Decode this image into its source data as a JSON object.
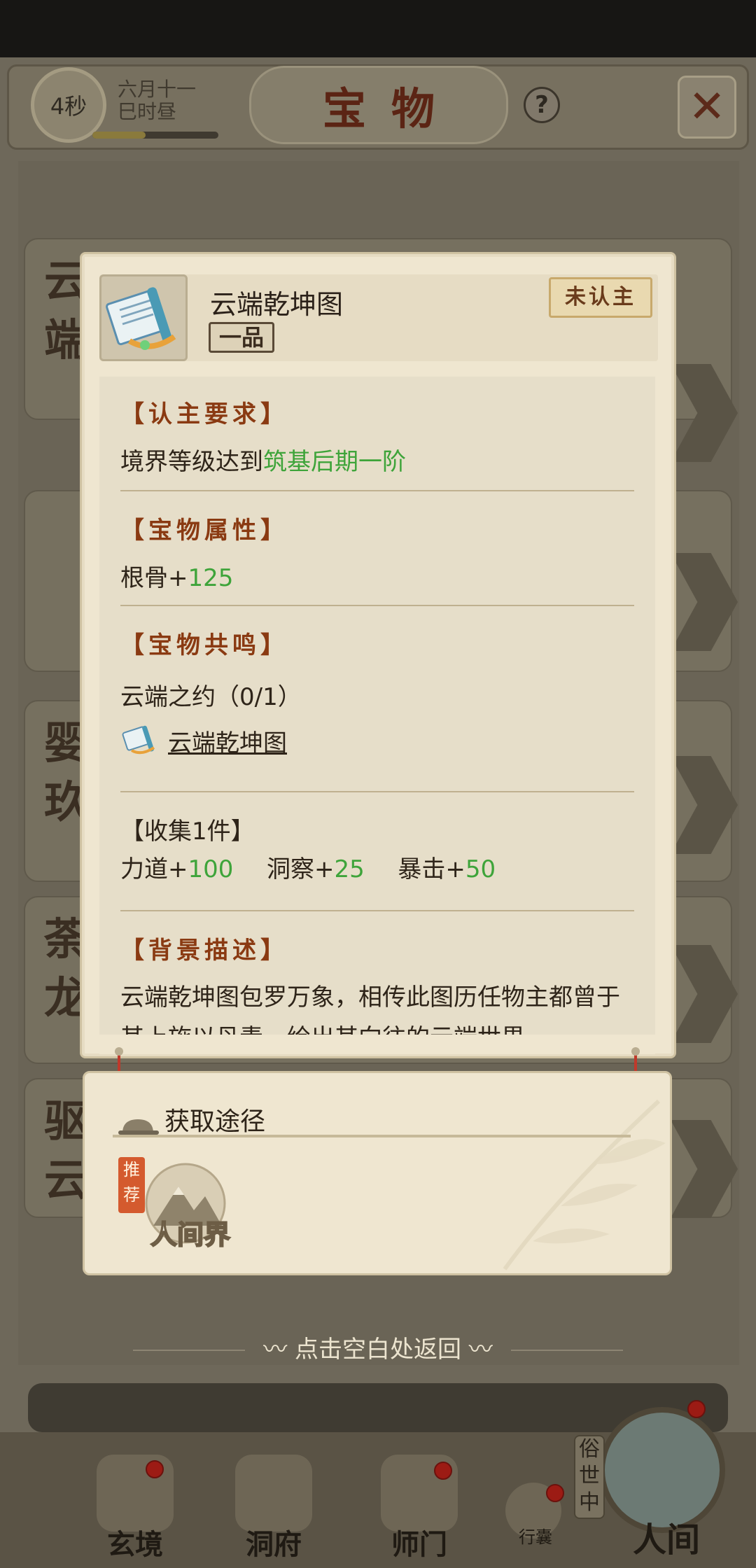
{
  "header": {
    "timer": "4秒",
    "date_line1": "六月十一",
    "date_line2": "巳时昼",
    "title": "宝物",
    "help_label": "?",
    "time_progress": 0.42
  },
  "background_items": [
    {
      "seal": "云端"
    },
    {
      "seal": ""
    },
    {
      "seal": "婴玖"
    },
    {
      "seal": "荼龙"
    },
    {
      "seal": "驱云"
    }
  ],
  "item": {
    "name": "云端乾坤图",
    "grade": "一品",
    "status_badge": "未认主",
    "requirement": {
      "title": "【认主要求】",
      "prefix": "境界等级达到",
      "value": "筑基后期一阶"
    },
    "attributes": {
      "title": "【宝物属性】",
      "stat_name": "根骨+",
      "stat_value": "125"
    },
    "resonance": {
      "title": "【宝物共鸣】",
      "set_line": "云端之约（0/1）",
      "link_item": "云端乾坤图",
      "collect_label": "【收集1件】",
      "bonuses": [
        {
          "name": "力道+",
          "value": "100"
        },
        {
          "name": "洞察+",
          "value": "25"
        },
        {
          "name": "暴击+",
          "value": "50"
        }
      ]
    },
    "background": {
      "title": "【背景描述】",
      "text": "云端乾坤图包罗万象，相传此图历任物主都曾于其上施以丹青，绘出其向往的云端世界"
    }
  },
  "source": {
    "title": "获取途径",
    "recommend_badge": "推荐",
    "location": "人间界"
  },
  "dismiss_hint": "点击空白处返回",
  "bottom_nav": {
    "items": [
      "玄境",
      "洞府",
      "师门",
      "行囊"
    ],
    "world_tag": "俗世中",
    "world_label": "人间"
  },
  "colors": {
    "accent_title": "#8a3a12",
    "positive_value": "#3ea43a",
    "card_bg": "#efe6d0"
  }
}
